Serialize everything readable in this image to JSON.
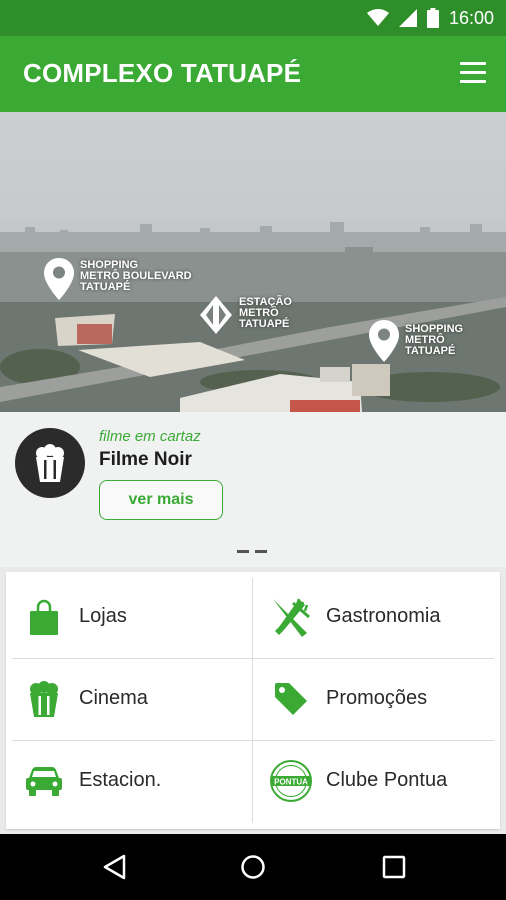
{
  "status_bar": {
    "time": "16:00",
    "icons": [
      "wifi-icon",
      "signal-icon",
      "battery-icon"
    ]
  },
  "app_bar": {
    "title": "COMPLEXO TATUAPÉ",
    "menu_icon": "hamburger-menu-icon"
  },
  "hero": {
    "pins": [
      {
        "label": "SHOPPING\nMETRÔ BOULEVARD\nTATUAPÉ",
        "icon": "map-pin-icon"
      },
      {
        "label": "ESTAÇÃO\nMETRÔ\nTATUAPÉ",
        "icon": "metro-logo-icon"
      },
      {
        "label": "SHOPPING\nMETRÔ\nTATUAPÉ",
        "icon": "map-pin-icon"
      }
    ],
    "movie": {
      "kicker": "filme em cartaz",
      "title": "Filme Noir",
      "button": "ver mais",
      "icon": "popcorn-icon"
    }
  },
  "menu": {
    "items": [
      {
        "label": "Lojas",
        "icon": "shopping-bag-icon"
      },
      {
        "label": "Gastronomia",
        "icon": "fork-knife-icon"
      },
      {
        "label": "Cinema",
        "icon": "popcorn-icon"
      },
      {
        "label": "Promoções",
        "icon": "tag-icon"
      },
      {
        "label": "Estacion.",
        "icon": "car-icon"
      },
      {
        "label": "Clube Pontua",
        "icon": "pontua-badge-icon"
      }
    ],
    "badge_text": "PONTUA"
  },
  "nav": {
    "icons": [
      "back-icon",
      "home-icon",
      "recents-icon"
    ]
  },
  "colors": {
    "primary": "#3aaa35",
    "primary_dark": "#2e8f2a"
  }
}
